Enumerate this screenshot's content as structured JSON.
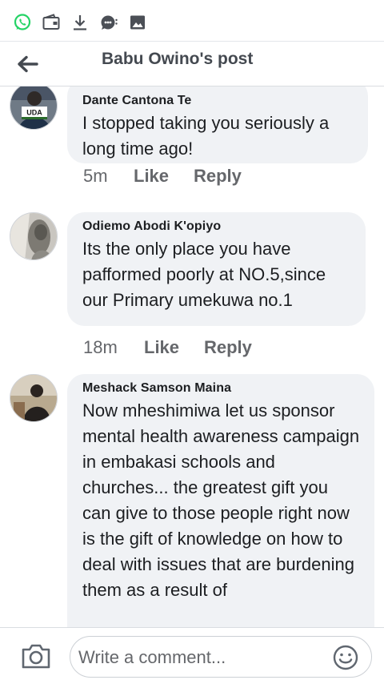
{
  "status_bar": {
    "icons": [
      "whatsapp-icon",
      "wallet-icon",
      "download-icon",
      "chat-bubble-icon",
      "image-icon"
    ]
  },
  "header": {
    "title": "Babu Owino's post",
    "back_icon": "arrow-left-icon"
  },
  "comments": [
    {
      "author": "Dante Cantona Te",
      "text": "I stopped taking you seriously a long time ago!",
      "time": "5m",
      "like_label": "Like",
      "reply_label": "Reply",
      "avatar_badge": "UDA"
    },
    {
      "author": "Odiemo Abodi K'opiyo",
      "text": "Its the only place you have pafformed poorly at NO.5,since our Primary umekuwa no.1",
      "time": "18m",
      "like_label": "Like",
      "reply_label": "Reply"
    },
    {
      "author": "Meshack Samson Maina",
      "text": "Now mheshimiwa let us sponsor  mental health awareness campaign in embakasi schools and churches... the greatest gift you can give to those people right now is the gift of knowledge on how to deal with issues that are burdening them as a result of"
    }
  ],
  "composer": {
    "placeholder": "Write a comment...",
    "camera_icon": "camera-icon",
    "emoji_icon": "smiley-icon"
  },
  "colors": {
    "whatsapp": "#25d366",
    "icon_gray": "#4b4f56",
    "bubble": "#f0f2f5",
    "meta": "#65676b"
  }
}
